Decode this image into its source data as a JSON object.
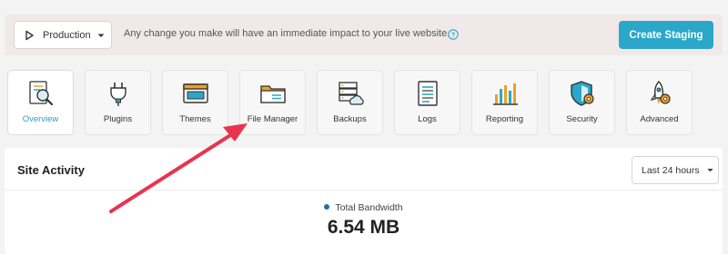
{
  "environment": {
    "selected": "Production",
    "notice": "Any change you make will have an immediate impact to your live website.",
    "staging_button": "Create Staging"
  },
  "tools": [
    {
      "label": "Overview",
      "icon": "overview-magnifier-icon",
      "active": true
    },
    {
      "label": "Plugins",
      "icon": "plug-icon",
      "active": false
    },
    {
      "label": "Themes",
      "icon": "browser-window-icon",
      "active": false
    },
    {
      "label": "File Manager",
      "icon": "folder-icon",
      "active": false
    },
    {
      "label": "Backups",
      "icon": "server-cloud-icon",
      "active": false
    },
    {
      "label": "Logs",
      "icon": "document-icon",
      "active": false
    },
    {
      "label": "Reporting",
      "icon": "bar-chart-icon",
      "active": false
    },
    {
      "label": "Security",
      "icon": "shield-gear-icon",
      "active": false
    },
    {
      "label": "Advanced",
      "icon": "rocket-gear-icon",
      "active": false
    }
  ],
  "activity": {
    "title": "Site Activity",
    "range": "Last 24 hours",
    "metric_label": "Total Bandwidth",
    "metric_value": "6.54 MB"
  },
  "colors": {
    "accent": "#2aa7c9",
    "banner": "#f1e9e9",
    "annotation": "#e8344e"
  }
}
